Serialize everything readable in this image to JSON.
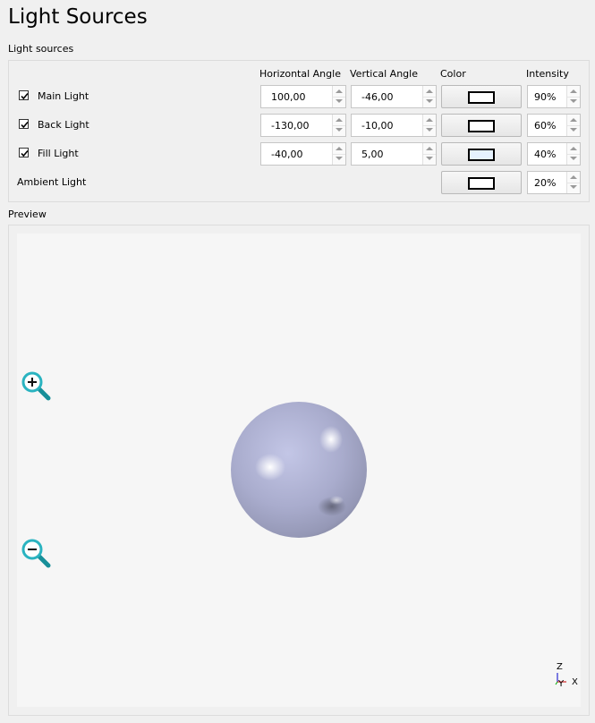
{
  "page_title": "Light Sources",
  "light_sources": {
    "group_label": "Light sources",
    "headers": {
      "horizontal_angle": "Horizontal Angle",
      "vertical_angle": "Vertical Angle",
      "color": "Color",
      "intensity": "Intensity"
    },
    "rows": [
      {
        "label": "Main Light",
        "checked": true,
        "horizontal": "100,00",
        "vertical": "-46,00",
        "color": "#ffffff",
        "intensity": "90%"
      },
      {
        "label": "Back Light",
        "checked": true,
        "horizontal": "-130,00",
        "vertical": "-10,00",
        "color": "#ffffff",
        "intensity": "60%"
      },
      {
        "label": "Fill Light",
        "checked": true,
        "horizontal": "-40,00",
        "vertical": "5,00",
        "color": "#e6f2ff",
        "intensity": "40%"
      }
    ],
    "ambient": {
      "label": "Ambient Light",
      "color": "#ffffff",
      "intensity": "20%"
    }
  },
  "preview": {
    "group_label": "Preview",
    "zoom_in_icon": "zoom-in-icon",
    "zoom_out_icon": "zoom-out-icon",
    "axes": {
      "z": "Z",
      "y": "Y",
      "x": "X"
    },
    "sphere_color": "#a9accd",
    "icon_color": "#2ab3c0"
  }
}
